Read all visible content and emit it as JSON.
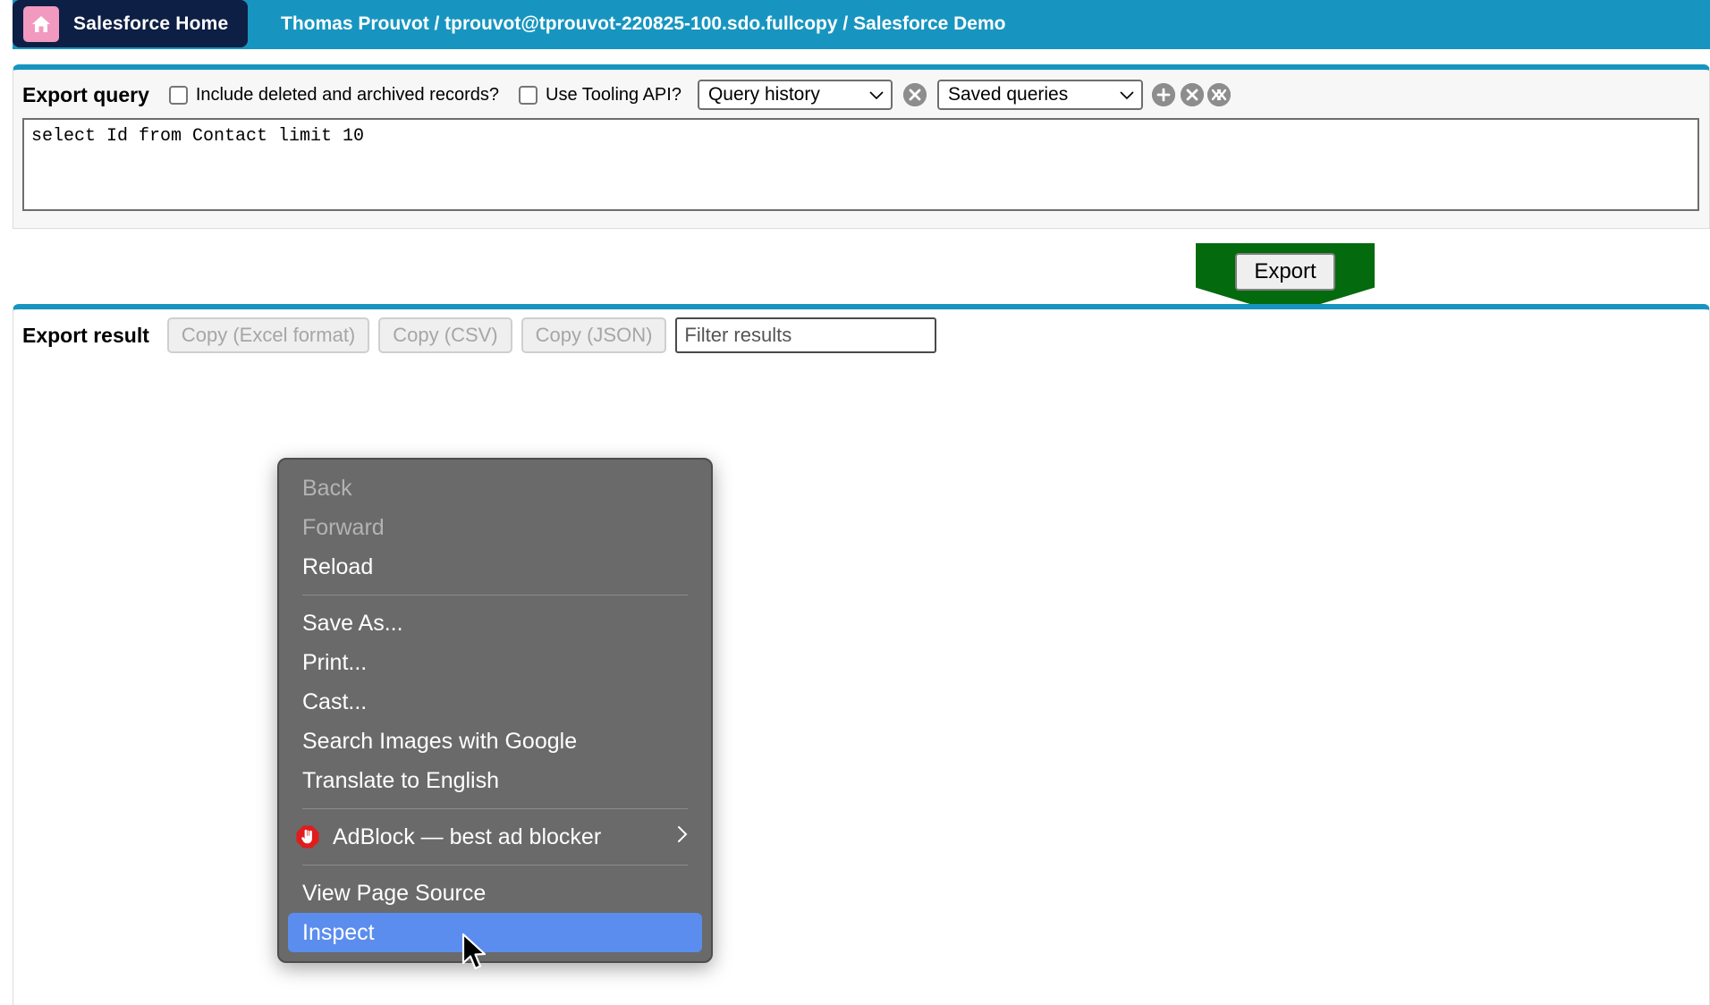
{
  "header": {
    "home_label": "Salesforce Home",
    "home_icon": "home-icon",
    "org_info": "Thomas Prouvot / tprouvot@tprouvot-220825-100.sdo.fullcopy / Salesforce Demo",
    "bar_color": "#1795c0",
    "pill_color": "#0d1f44",
    "home_icon_color": "#f299bf"
  },
  "export_query": {
    "title": "Export query",
    "include_deleted": {
      "label": "Include deleted and archived records?",
      "checked": false
    },
    "use_tooling_api": {
      "label": "Use Tooling API?",
      "checked": false
    },
    "query_history": {
      "selected": "Query history",
      "clear_icon": "x-circle-icon"
    },
    "saved_queries": {
      "selected": "Saved queries",
      "add_icon": "plus-circle-icon",
      "delete_icon": "x-circle-icon",
      "delete_all_icon": "double-x-circle-icon"
    },
    "query_text": "select Id from Contact limit 10"
  },
  "export_action": {
    "button_label": "Export",
    "highlight_color": "#046a0e"
  },
  "export_result": {
    "title": "Export result",
    "buttons": [
      {
        "label": "Copy (Excel format)",
        "disabled": true
      },
      {
        "label": "Copy (CSV)",
        "disabled": true
      },
      {
        "label": "Copy (JSON)",
        "disabled": true
      }
    ],
    "filter": {
      "value": "",
      "placeholder": "Filter results"
    }
  },
  "context_menu": {
    "highlight_color": "#5b8def",
    "background_color": "#6a6a6a",
    "items": [
      {
        "label": "Back",
        "state": "disabled"
      },
      {
        "label": "Forward",
        "state": "disabled"
      },
      {
        "label": "Reload",
        "state": "normal"
      },
      {
        "type": "separator"
      },
      {
        "label": "Save As...",
        "state": "normal"
      },
      {
        "label": "Print...",
        "state": "normal"
      },
      {
        "label": "Cast...",
        "state": "normal"
      },
      {
        "label": "Search Images with Google",
        "state": "normal"
      },
      {
        "label": "Translate to English",
        "state": "normal"
      },
      {
        "type": "separator"
      },
      {
        "label": "AdBlock — best ad blocker",
        "state": "normal",
        "icon": "adblock-hand-icon",
        "submenu": true
      },
      {
        "type": "separator"
      },
      {
        "label": "View Page Source",
        "state": "normal"
      },
      {
        "label": "Inspect",
        "state": "highlighted"
      }
    ]
  },
  "cursor": {
    "icon": "arrow-cursor-icon"
  }
}
